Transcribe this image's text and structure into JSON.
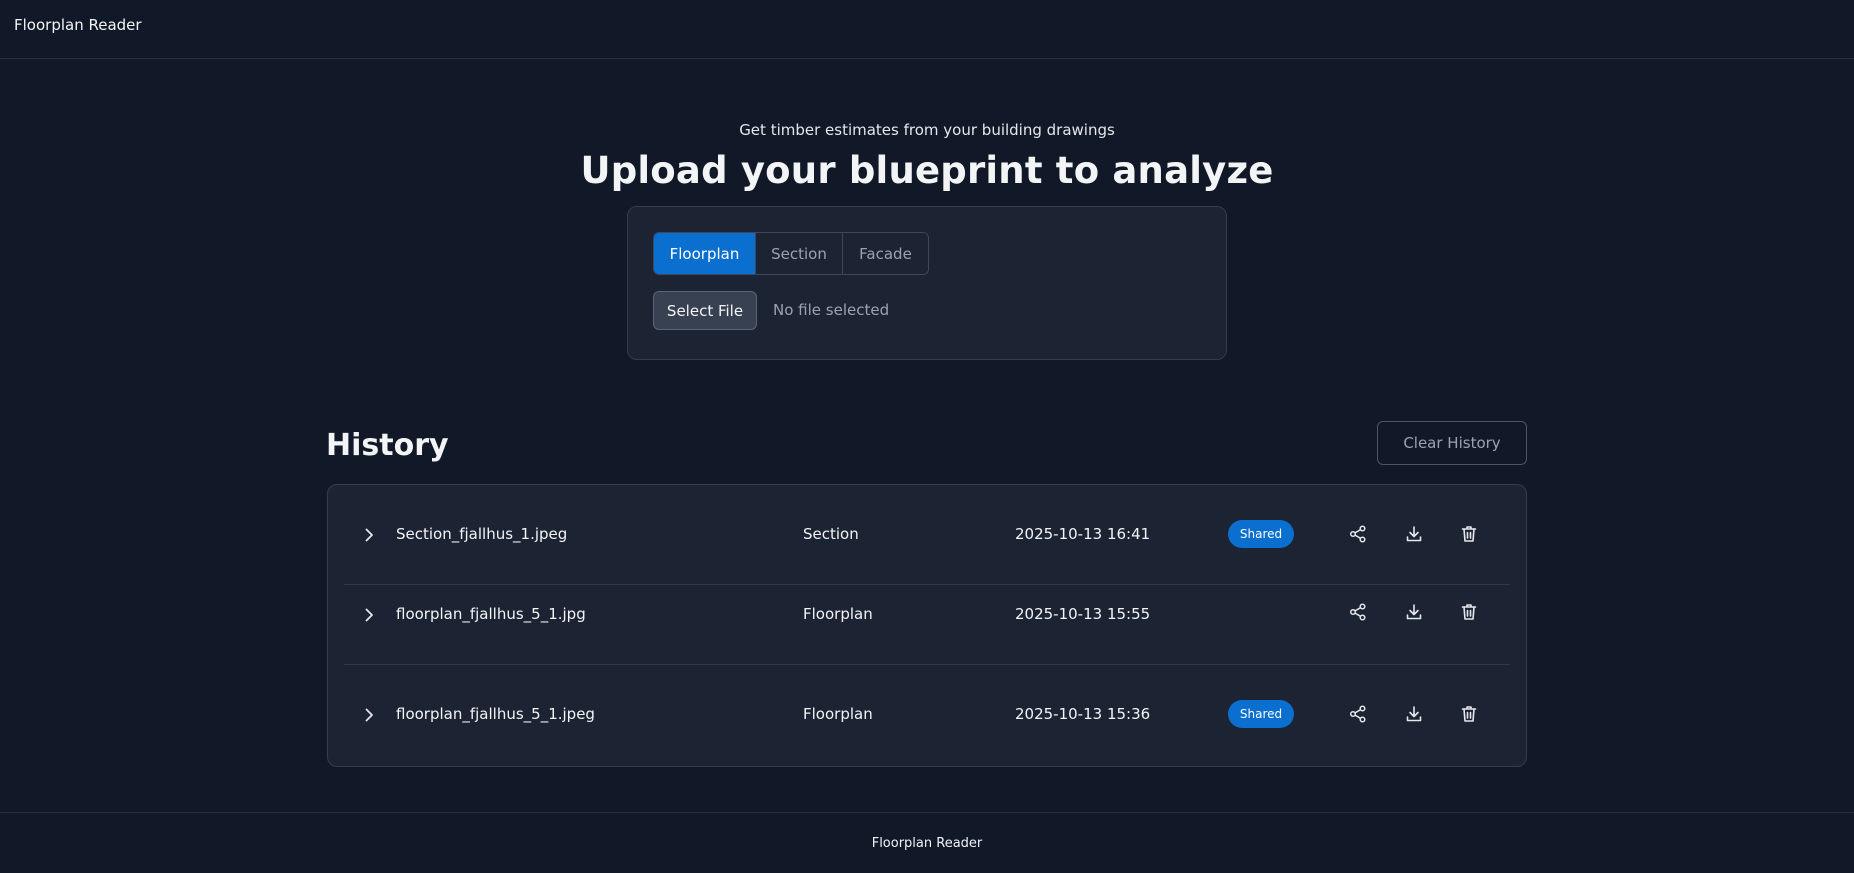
{
  "header": {
    "app_name": "Floorplan Reader"
  },
  "upload": {
    "subtitle": "Get timber estimates from your building drawings",
    "title": "Upload your blueprint to analyze",
    "tabs": [
      {
        "label": "Floorplan",
        "active": true
      },
      {
        "label": "Section",
        "active": false
      },
      {
        "label": "Facade",
        "active": false
      }
    ],
    "select_file_label": "Select File",
    "file_status": "No file selected"
  },
  "history": {
    "title": "History",
    "clear_label": "Clear History",
    "rows": [
      {
        "file_name": "Section_fjallhus_1.jpeg",
        "type": "Section",
        "date": "2025-10-13 16:41",
        "badge": "Shared"
      },
      {
        "file_name": "floorplan_fjallhus_5_1.jpg",
        "type": "Floorplan",
        "date": "2025-10-13 15:55",
        "badge": ""
      },
      {
        "file_name": "floorplan_fjallhus_5_1.jpeg",
        "type": "Floorplan",
        "date": "2025-10-13 15:36",
        "badge": "Shared"
      }
    ],
    "row_icons": [
      "chevron-right-icon",
      "share-icon",
      "download-icon",
      "trash-icon"
    ]
  },
  "footer": {
    "text": "Floorplan Reader"
  },
  "colors": {
    "background": "#111827",
    "card": "#1c2333",
    "accent": "#0b6fd0"
  }
}
